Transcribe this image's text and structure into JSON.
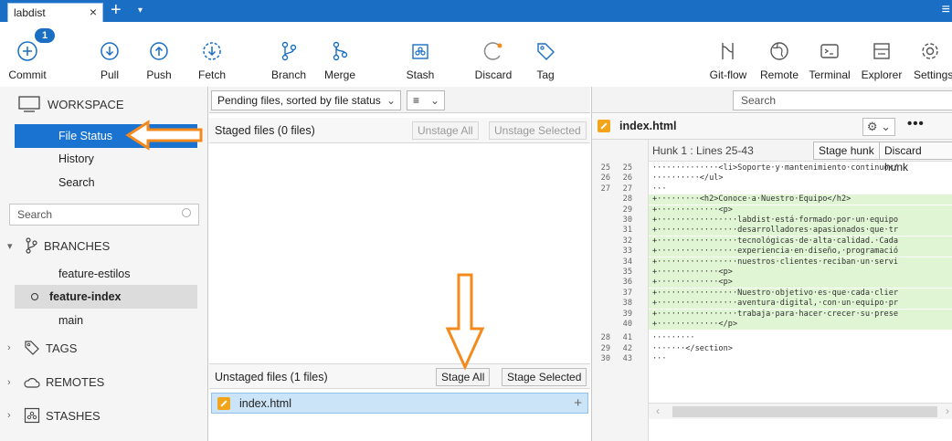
{
  "titlebar": {
    "tab_label": "labdist",
    "close": "×",
    "new_tab": "+",
    "chevron": "▾",
    "menu": "≡"
  },
  "toolbar": {
    "badge": "1",
    "buttons": [
      {
        "id": "commit",
        "label": "Commit",
        "icon": "plus-circle-icon"
      },
      {
        "id": "pull",
        "label": "Pull",
        "icon": "arrow-down-circle-icon"
      },
      {
        "id": "push",
        "label": "Push",
        "icon": "arrow-up-circle-icon"
      },
      {
        "id": "fetch",
        "label": "Fetch",
        "icon": "dashed-arrow-down-circle-icon"
      },
      {
        "id": "branch",
        "label": "Branch",
        "icon": "branch-icon"
      },
      {
        "id": "merge",
        "label": "Merge",
        "icon": "merge-icon"
      },
      {
        "id": "stash",
        "label": "Stash",
        "icon": "stash-icon"
      },
      {
        "id": "discard",
        "label": "Discard",
        "icon": "discard-icon"
      },
      {
        "id": "tag",
        "label": "Tag",
        "icon": "tag-icon"
      },
      {
        "id": "gitflow",
        "label": "Git-flow",
        "icon": "gitflow-icon"
      },
      {
        "id": "remote",
        "label": "Remote",
        "icon": "globe-icon"
      },
      {
        "id": "terminal",
        "label": "Terminal",
        "icon": "terminal-icon"
      },
      {
        "id": "explorer",
        "label": "Explorer",
        "icon": "folder-icon"
      },
      {
        "id": "settings",
        "label": "Settings",
        "icon": "gear-icon"
      }
    ]
  },
  "sidebar": {
    "workspace": "WORKSPACE",
    "workspace_items": [
      "File Status",
      "History",
      "Search"
    ],
    "search_placeholder": "Search",
    "branches": "BRANCHES",
    "branch_items": [
      "feature-estilos",
      "feature-index",
      "main"
    ],
    "tags": "TAGS",
    "remotes": "REMOTES",
    "stashes": "STASHES"
  },
  "middle": {
    "sort_dropdown": "Pending files, sorted by file status",
    "view_dropdown": "≡",
    "staged_title": "Staged files  (0 files)",
    "unstage_all": "Unstage All",
    "unstage_selected": "Unstage Selected",
    "unstaged_title": "Unstaged files  (1 files)",
    "stage_all": "Stage All",
    "stage_selected": "Stage Selected",
    "unstaged_files": [
      "index.html"
    ]
  },
  "right": {
    "search_placeholder": "Search",
    "file_name": "index.html",
    "hunk_label": "Hunk 1 : Lines 25-43",
    "stage_hunk": "Stage hunk",
    "discard_hunk": "Discard hunk",
    "more": "•••",
    "lines": [
      {
        "a": "25",
        "b": "25",
        "add": false,
        "text": "··············<li>Soporte·y·mantenimiento·continuo</"
      },
      {
        "a": "26",
        "b": "26",
        "add": false,
        "text": "··········</ul>"
      },
      {
        "a": "27",
        "b": "27",
        "add": false,
        "text": "···"
      },
      {
        "a": "",
        "b": "28",
        "add": true,
        "text": "+·········<h2>Conoce·a·Nuestro·Equipo</h2>"
      },
      {
        "a": "",
        "b": "29",
        "add": true,
        "text": "+·············<p>"
      },
      {
        "a": "",
        "b": "30",
        "add": true,
        "text": "+·················labdist·está·formado·por·un·equipo"
      },
      {
        "a": "",
        "b": "31",
        "add": true,
        "text": "+·················desarrolladores·apasionados·que·tr"
      },
      {
        "a": "",
        "b": "32",
        "add": true,
        "text": "+·················tecnológicas·de·alta·calidad.·Cada"
      },
      {
        "a": "",
        "b": "33",
        "add": true,
        "text": "+·················experiencia·en·diseño,·programació"
      },
      {
        "a": "",
        "b": "34",
        "add": true,
        "text": "+·················nuestros·clientes·reciban·un·servi"
      },
      {
        "a": "",
        "b": "35",
        "add": true,
        "text": "+·············<p>"
      },
      {
        "a": "",
        "b": "36",
        "add": true,
        "text": "+·············<p>"
      },
      {
        "a": "",
        "b": "37",
        "add": true,
        "text": "+·················Nuestro·objetivo·es·que·cada·clier"
      },
      {
        "a": "",
        "b": "38",
        "add": true,
        "text": "+·················aventura·digital,·con·un·equipo·pr"
      },
      {
        "a": "",
        "b": "39",
        "add": true,
        "text": "+·················trabaja·para·hacer·crecer·su·prese"
      },
      {
        "a": "",
        "b": "40",
        "add": true,
        "text": "+·············</p>"
      },
      {
        "a": "28",
        "b": "41",
        "add": false,
        "text": "·········"
      },
      {
        "a": "29",
        "b": "42",
        "add": false,
        "text": "·······</section>"
      },
      {
        "a": "30",
        "b": "43",
        "add": false,
        "text": "···"
      }
    ]
  },
  "colors": {
    "accent": "#1a6fc4",
    "selection": "#1a73d1",
    "annotation": "#f48a1c",
    "added_line": "#dff5d3"
  }
}
